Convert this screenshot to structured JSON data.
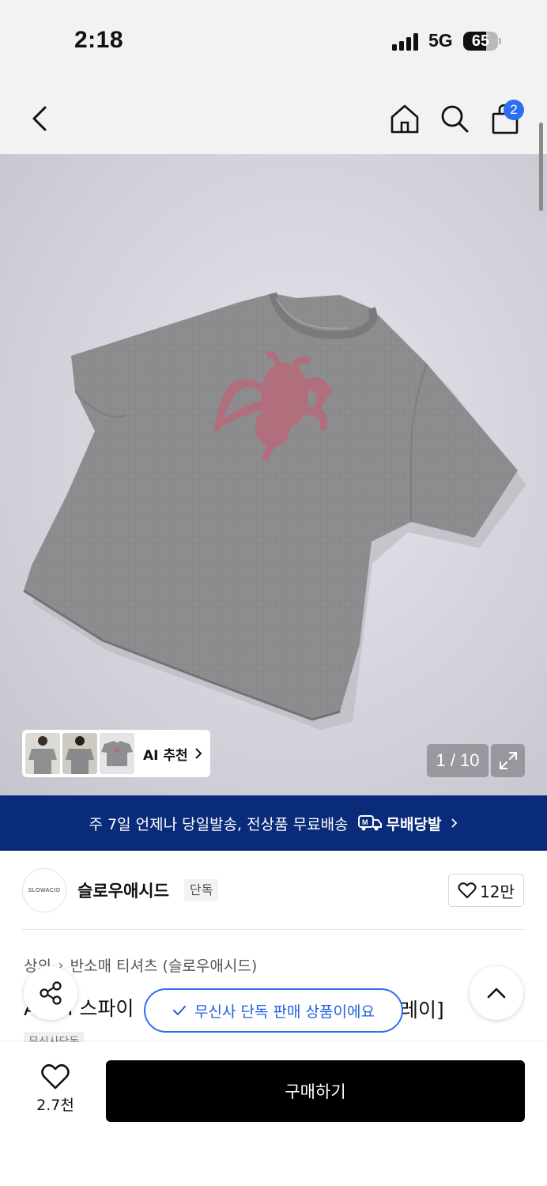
{
  "status_bar": {
    "time": "2:18",
    "network": "5G",
    "battery": "65",
    "battery_level_percent": 65
  },
  "nav": {
    "back_icon": "chevron-left-icon",
    "home_icon": "home-icon",
    "search_icon": "search-icon",
    "cart_icon": "shopping-bag-icon",
    "cart_count": "2"
  },
  "gallery": {
    "ai_recommend_label": "AI 추천",
    "page_counter": "1 / 10",
    "expand_icon": "expand-icon"
  },
  "banner": {
    "text": "주 7일 언제나 당일발송, 전상품 무료배송",
    "brand": "무배당발"
  },
  "brand": {
    "logo_text": "SLOWACID",
    "name": "슬로우애시드",
    "tag": "단독",
    "likes": "12만"
  },
  "product": {
    "breadcrumb": [
      "상의",
      "반소매 티셔츠 (슬로우애시드)"
    ],
    "title_left": "A",
    "title_mid": "I 스파이",
    "title_right": "레이]",
    "partial_tag": "무신사단독"
  },
  "toast": {
    "text": "무신사 단독 판매 상품이에요"
  },
  "bottom_bar": {
    "wish_count": "2.7천",
    "buy_label": "구매하기"
  },
  "colors": {
    "accent_blue": "#2c6ef2",
    "banner_navy": "#0a2a7a",
    "buy_button": "#000000"
  }
}
